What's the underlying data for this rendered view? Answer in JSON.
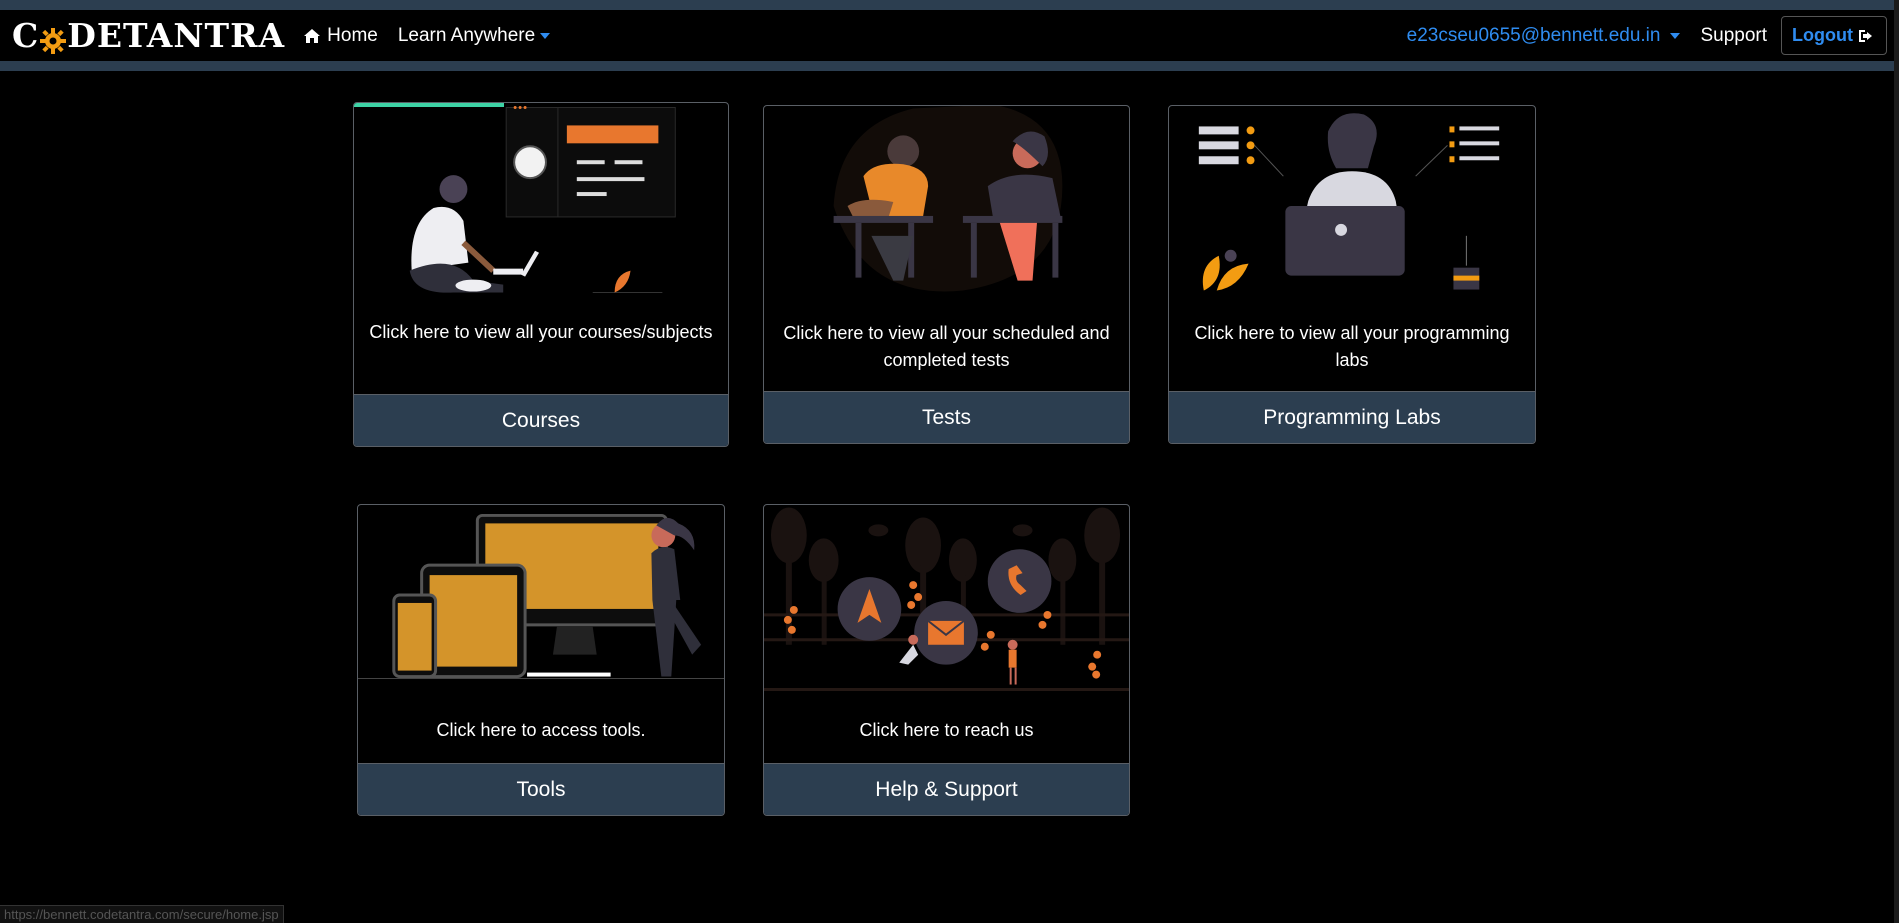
{
  "brand": {
    "text_before": "C",
    "text_after": "DETANTRA",
    "gear_color": "#f39c12"
  },
  "nav": {
    "home_label": "Home",
    "learn_label": "Learn Anywhere",
    "user_email": "e23cseu0655@bennett.edu.in",
    "support_label": "Support",
    "logout_label": "Logout"
  },
  "cards": {
    "courses": {
      "description": "Click here to view all your courses/subjects",
      "title": "Courses"
    },
    "tests": {
      "description": "Click here to view all your scheduled and completed tests",
      "title": "Tests"
    },
    "labs": {
      "description": "Click here to view all your programming labs",
      "title": "Programming Labs"
    },
    "tools": {
      "description": "Click here to access tools.",
      "title": "Tools"
    },
    "help": {
      "description": "Click here to reach us",
      "title": "Help & Support"
    }
  },
  "status_url": "https://bennett.codetantra.com/secure/home.jsp",
  "colors": {
    "accent_blue": "#2f8cf0",
    "navbar_border": "#2c3e50",
    "card_footer": "#2c3e50",
    "orange": "#e8772e",
    "gold": "#d4942a"
  }
}
